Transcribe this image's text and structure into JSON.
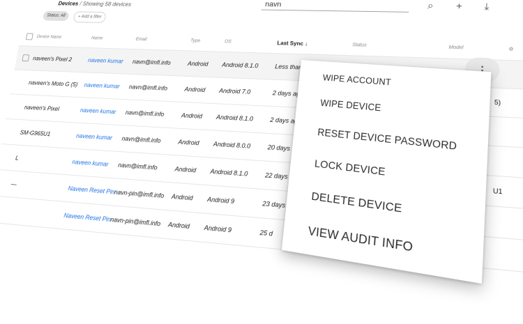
{
  "topbar": {
    "breadcrumb_title": "Devices",
    "breadcrumb_count": "Showing 58 devices",
    "search_value": "navn",
    "search_icon": "search-icon",
    "add_icon": "add-icon",
    "download_icon": "download-icon"
  },
  "filters": {
    "status_chip": "Status: All",
    "add_filter": "+  Add a filter"
  },
  "table": {
    "headers": {
      "device_name": "Device Name",
      "name": "Name",
      "email": "Email",
      "type": "Type",
      "os": "OS",
      "last_sync": "Last Sync",
      "sort_icon": "↓",
      "status": "Status",
      "model": "Model",
      "settings_icon": "settings-gear-icon"
    },
    "rows": [
      {
        "device": "naveen's Pixel 2",
        "name": "naveen kumar",
        "email": "navn@imfl.info",
        "type": "Android",
        "os": "Android 8.1.0",
        "sync": "Less than 1 hour",
        "extra": ""
      },
      {
        "device": "naveen's Moto G (5)",
        "name": "naveen kumar",
        "email": "navn@imfl.info",
        "type": "Android",
        "os": "Android 7.0",
        "sync": "2 days ago",
        "extra": "5)"
      },
      {
        "device": "naveen's Pixel",
        "name": "naveen kumar",
        "email": "navn@imfl.info",
        "type": "Android",
        "os": "Android 8.1.0",
        "sync": "2 days ago",
        "extra": ""
      },
      {
        "device": "SM-G965U1",
        "name": "naveen kumar",
        "email": "navn@imfl.info",
        "type": "Android",
        "os": "Android 8.0.0",
        "sync": "20 days ago",
        "extra": ""
      },
      {
        "device": "L",
        "name": "naveen kumar",
        "email": "navn@imfl.info",
        "type": "Android",
        "os": "Android 8.1.0",
        "sync": "22 days ago",
        "extra": "U1"
      },
      {
        "device": "—",
        "name": "Naveen Reset Pin",
        "email": "navn-pin@imfl.info",
        "type": "Android",
        "os": "Android 9",
        "sync": "23 days ago",
        "extra": ""
      },
      {
        "device": "",
        "name": "Naveen Reset Pin",
        "email": "navn-pin@imfl.info",
        "type": "Android",
        "os": "Android 9",
        "sync": "25 d",
        "extra": ""
      }
    ]
  },
  "row_menu": {
    "kebab_icon": "more-vert-icon",
    "items": [
      "WIPE ACCOUNT",
      "WIPE DEVICE",
      "RESET DEVICE PASSWORD",
      "LOCK DEVICE",
      "DELETE DEVICE",
      "VIEW AUDIT INFO"
    ]
  }
}
